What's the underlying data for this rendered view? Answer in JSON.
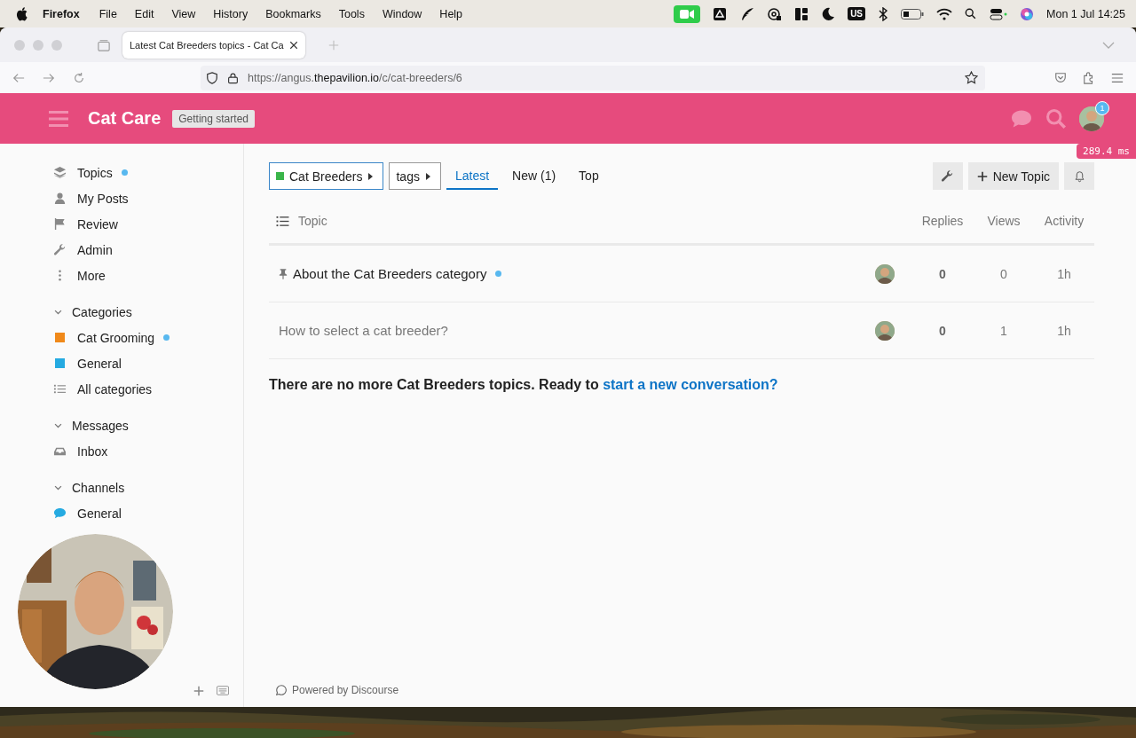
{
  "menubar": {
    "app": "Firefox",
    "menus": [
      "File",
      "Edit",
      "View",
      "History",
      "Bookmarks",
      "Tools",
      "Window",
      "Help"
    ],
    "input_source": "US",
    "clock": "Mon 1 Jul  14:25"
  },
  "browser": {
    "tab": {
      "title": "Latest Cat Breeders topics - Cat Ca",
      "selected": true
    },
    "url": "https://angus.**thepavilion.io**/c/cat-breeders/6"
  },
  "header": {
    "title": "Cat Care",
    "badge": "Getting started",
    "notifications": "1"
  },
  "perf_badge": "289.4 ms",
  "sidebar": {
    "items": [
      {
        "kind": "topics",
        "label": "Topics",
        "unread": true
      },
      {
        "kind": "posts",
        "label": "My Posts",
        "unread": false
      },
      {
        "kind": "review",
        "label": "Review",
        "unread": false
      },
      {
        "kind": "admin",
        "label": "Admin",
        "unread": false
      },
      {
        "kind": "more",
        "label": "More",
        "unread": false
      }
    ],
    "sections": [
      {
        "title": "Categories",
        "expanded": true,
        "items": [
          {
            "kind": "category",
            "label": "Cat Grooming",
            "color": "#f0891a",
            "unread": true
          },
          {
            "kind": "category",
            "label": "General",
            "color": "#25aae1",
            "unread": false
          },
          {
            "kind": "all",
            "label": "All categories",
            "unread": false
          }
        ]
      },
      {
        "title": "Messages",
        "expanded": true,
        "items": [
          {
            "kind": "inbox",
            "label": "Inbox",
            "unread": false
          }
        ]
      },
      {
        "title": "Channels",
        "expanded": true,
        "items": [
          {
            "kind": "channel",
            "label": "General",
            "color": "#25aae1",
            "unread": false
          }
        ]
      }
    ]
  },
  "nav": {
    "category": {
      "label": "Cat Breeders",
      "color": "#3ab54a"
    },
    "tags": "tags",
    "tabs": [
      {
        "label": "Latest",
        "selected": true
      },
      {
        "label": "New (1)",
        "selected": false
      },
      {
        "label": "Top",
        "selected": false
      }
    ],
    "new_topic": "New Topic"
  },
  "topic_list": {
    "columns": [
      "Topic",
      "Replies",
      "Views",
      "Activity"
    ],
    "rows": [
      {
        "title": "About the Cat Breeders category",
        "pinned": true,
        "unread": true,
        "read": false,
        "replies": "0",
        "views": "0",
        "activity": "1h"
      },
      {
        "title": "How to select a cat breeder?",
        "pinned": false,
        "unread": false,
        "read": true,
        "replies": "0",
        "views": "1",
        "activity": "1h"
      }
    ]
  },
  "footer_message": {
    "text": "There are no more Cat Breeders topics. Ready to",
    "link": "start a new conversation?"
  },
  "powered_by": "Powered by Discourse"
}
